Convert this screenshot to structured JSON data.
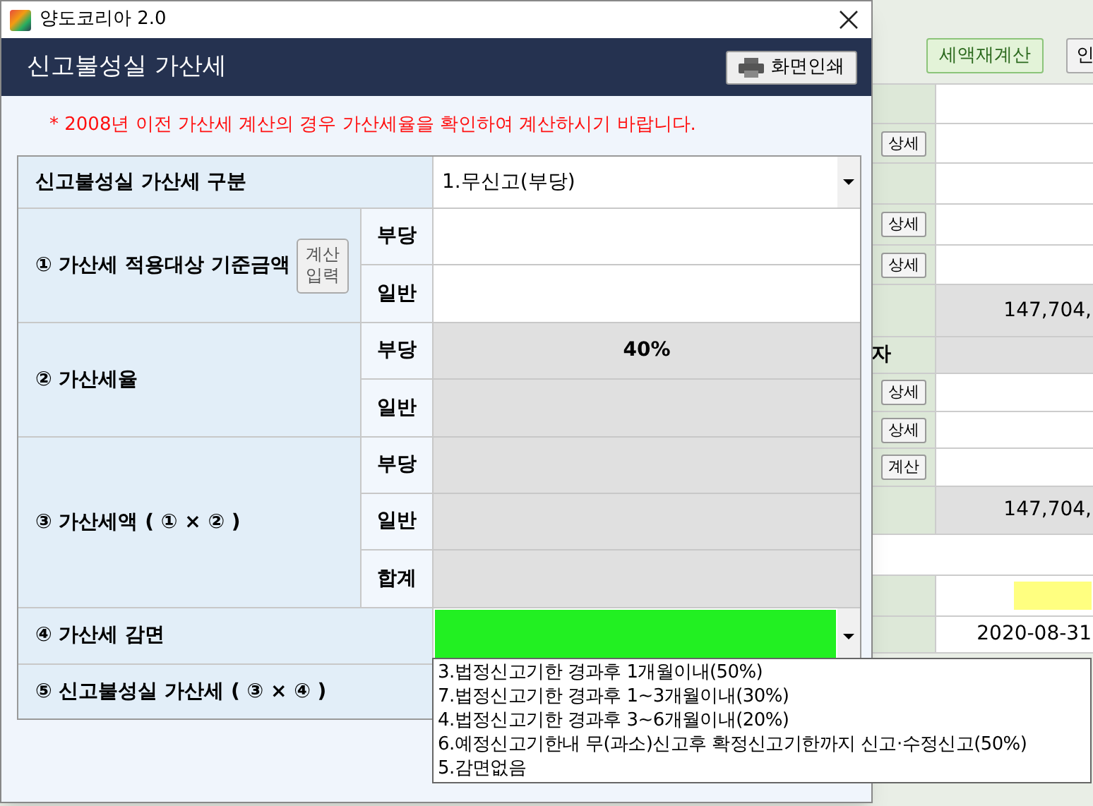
{
  "window": {
    "title": "양도코리아 2.0"
  },
  "dialog": {
    "title": "신고불성실 가산세",
    "print_button": "화면인쇄",
    "notice": "* 2008년 이전 가산세 계산의 경우 가산세율을 확인하여 계산하시기 바랍니다.",
    "type_row": {
      "label": "신고불성실 가산세 구분",
      "value": "1.무신고(부당)"
    },
    "sections": [
      {
        "kind": "input",
        "label": "① 가산세 적용대상 기준금액",
        "button": [
          "계산",
          "입력"
        ],
        "lines": [
          {
            "label": "부당"
          },
          {
            "label": "일반"
          }
        ]
      },
      {
        "kind": "computed",
        "label": "② 가산세율",
        "lines": [
          {
            "label": "부당",
            "value": "40%"
          },
          {
            "label": "일반"
          }
        ]
      },
      {
        "kind": "computed",
        "label": "③ 가산세액 ( ① × ② )",
        "lines": [
          {
            "label": "부당"
          },
          {
            "label": "일반"
          },
          {
            "label": "합계"
          }
        ]
      }
    ],
    "reduction": {
      "label": "④ 가산세 감면",
      "expanded": true,
      "options": [
        {
          "label": "3.법정신고기한 경과후 1개월이내(50%)"
        },
        {
          "label": "7.법정신고기한 경과후 1~3개월이내(30%)"
        },
        {
          "label": "4.법정신고기한 경과후 3~6개월이내(20%)"
        },
        {
          "label": "6.예정신고기한내 무(과소)신고후 확정신고기한까지 신고·수정신고(50%)"
        },
        {
          "label": "5.감면없음"
        }
      ]
    },
    "result": {
      "label": "⑤ 신고불성실 가산세 ( ③ × ④ )"
    }
  },
  "background_window": {
    "recalc_button": "세액재계산",
    "print_button": "인",
    "rows": [
      {
        "kind": "plain"
      },
      {
        "kind": "button",
        "button": "상세"
      },
      {
        "kind": "plain"
      },
      {
        "kind": "button",
        "button": "상세"
      },
      {
        "kind": "button",
        "button": "상세"
      },
      {
        "kind": "total",
        "value": "147,704,"
      },
      {
        "kind": "total",
        "label": "자"
      },
      {
        "kind": "button",
        "button": "상세"
      },
      {
        "kind": "button",
        "button": "상세"
      },
      {
        "kind": "button",
        "button": "계산"
      },
      {
        "kind": "total",
        "value": "147,704,"
      },
      {
        "kind": "blank"
      },
      {
        "kind": "highlight"
      },
      {
        "kind": "plain",
        "value": "2020-08-31"
      }
    ]
  }
}
